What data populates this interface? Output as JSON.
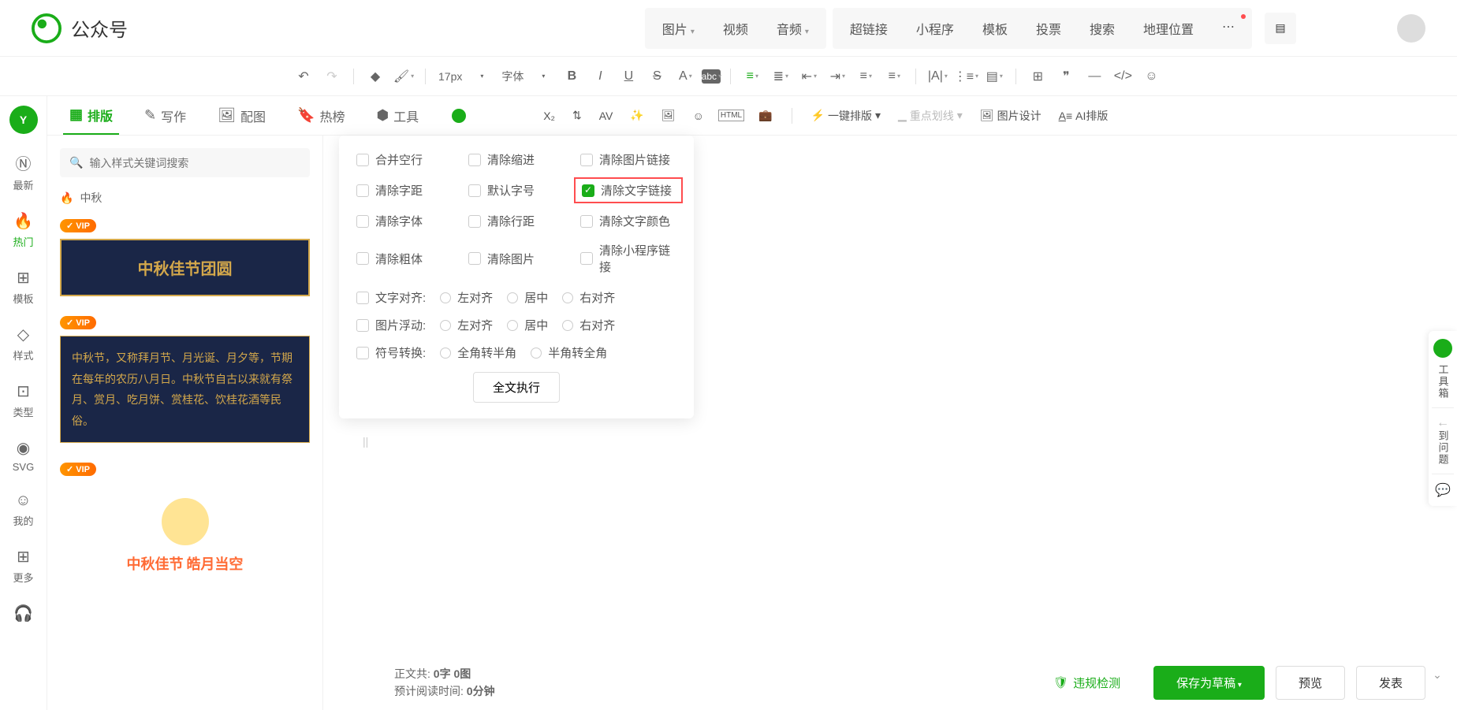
{
  "header": {
    "title": "公众号",
    "menus1": [
      "图片",
      "视频",
      "音频"
    ],
    "menus2": [
      "超链接",
      "小程序",
      "模板",
      "投票",
      "搜索",
      "地理位置"
    ]
  },
  "toolbar": {
    "fontsize": "17px",
    "fontfamily": "字体"
  },
  "tabs": {
    "items": [
      {
        "label": "排版",
        "active": true
      },
      {
        "label": "写作"
      },
      {
        "label": "配图"
      },
      {
        "label": "热榜"
      },
      {
        "label": "工具"
      }
    ]
  },
  "second_toolbar": {
    "auto_format": "一键排版",
    "highlight": "重点划线",
    "image_design": "图片设计",
    "ai_format": "AI排版"
  },
  "sidebar": {
    "items": [
      {
        "icon": "Ⓝ",
        "label": "最新"
      },
      {
        "icon": "🔥",
        "label": "热门",
        "active": true
      },
      {
        "icon": "⊞",
        "label": "模板"
      },
      {
        "icon": "◇",
        "label": "样式"
      },
      {
        "icon": "⊡",
        "label": "类型"
      },
      {
        "icon": "◉",
        "label": "SVG"
      },
      {
        "icon": "☺",
        "label": "我的"
      },
      {
        "icon": "⊞",
        "label": "更多"
      }
    ]
  },
  "search": {
    "placeholder": "输入样式关键词搜索"
  },
  "filter": {
    "label": "中秋"
  },
  "templates": {
    "card1_title": "中秋佳节团圆",
    "card2_text": "中秋节，又称拜月节、月光诞、月夕等，节期在每年的农历八月日。中秋节自古以来就有祭月、赏月、吃月饼、赏桂花、饮桂花酒等民俗。",
    "card3_t1": "中秋佳节",
    "card3_t2": "皓月当空"
  },
  "dropdown": {
    "col1": [
      "合并空行",
      "清除字距",
      "清除字体",
      "清除粗体"
    ],
    "col2": [
      "清除缩进",
      "默认字号",
      "清除行距",
      "清除图片"
    ],
    "col3": [
      "清除图片链接",
      "清除文字链接",
      "清除文字颜色",
      "清除小程序链接"
    ],
    "radio_rows": [
      {
        "label": "文字对齐:",
        "opts": [
          "左对齐",
          "居中",
          "右对齐"
        ]
      },
      {
        "label": "图片浮动:",
        "opts": [
          "左对齐",
          "居中",
          "右对齐"
        ]
      },
      {
        "label": "符号转换:",
        "opts": [
          "全角转半角",
          "半角转全角"
        ]
      }
    ],
    "execute_btn": "全文执行"
  },
  "footer": {
    "stats_label": "正文共:",
    "char_count": "0字",
    "img_count": "0图",
    "read_label": "预计阅读时间:",
    "read_time": "0分钟",
    "check": "违规检测",
    "save": "保存为草稿",
    "preview": "预览",
    "publish": "发表"
  },
  "float": {
    "toolbox": "工具箱",
    "feedback": "到问题"
  }
}
